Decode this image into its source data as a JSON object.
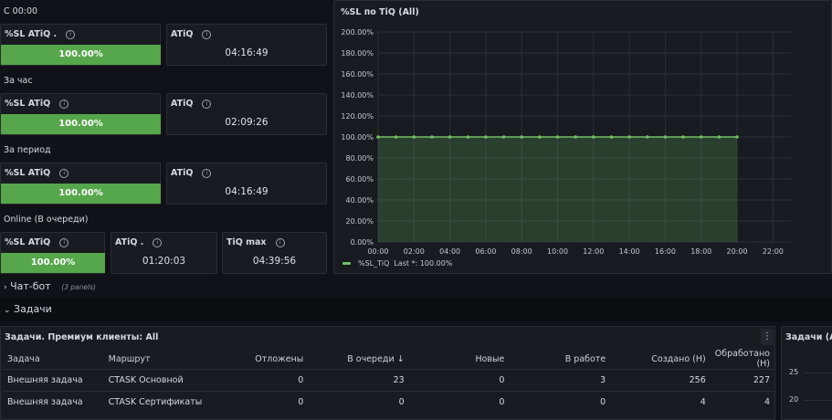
{
  "sections": {
    "since_midnight": "С 00:00",
    "per_hour": "За час",
    "per_period": "За период",
    "online": "Online (В очереди)"
  },
  "stats": {
    "r1_sl_title": "%SL ATiQ .",
    "r1_sl_value": "100.00%",
    "r1_atiq_title": "ATiQ",
    "r1_atiq_value": "04:16:49",
    "r2_sl_title": "%SL ATiQ",
    "r2_sl_value": "100.00%",
    "r2_atiq_title": "ATiQ",
    "r2_atiq_value": "02:09:26",
    "r3_sl_title": "%SL ATiQ",
    "r3_sl_value": "100.00%",
    "r3_atiq_title": "ATiQ",
    "r3_atiq_value": "04:16:49",
    "r4_sl_title": "%SL ATiQ",
    "r4_sl_value": "100.00%",
    "r4_atiq_title": "ATiQ .",
    "r4_atiq_value": "01:20:03",
    "r4_tiq_title": "TiQ max",
    "r4_tiq_value": "04:39:56",
    "bar_fill_fraction": 1.0
  },
  "chart_panel": {
    "title": "%SL по TiQ (All)",
    "legend_series": "%SL_TiQ",
    "legend_last": "Last *: 100.00%"
  },
  "chart_data": {
    "type": "area",
    "title": "%SL по TiQ (All)",
    "x_ticks": [
      "00:00",
      "02:00",
      "04:00",
      "06:00",
      "08:00",
      "10:00",
      "12:00",
      "14:00",
      "16:00",
      "18:00",
      "20:00",
      "22:00"
    ],
    "y_ticks": [
      "0.00%",
      "20.00%",
      "40.00%",
      "60.00%",
      "80.00%",
      "100.00%",
      "120.00%",
      "140.00%",
      "160.00%",
      "180.00%",
      "200.00%"
    ],
    "ylim": [
      0,
      200
    ],
    "xlim_hours": [
      0,
      23
    ],
    "series": [
      {
        "name": "%SL_TiQ",
        "color": "#73bf69",
        "x_hours": [
          0,
          1,
          2,
          3,
          4,
          5,
          6,
          7,
          8,
          9,
          10,
          11,
          12,
          13,
          14,
          15,
          16,
          17,
          18,
          19,
          20
        ],
        "values": [
          100,
          100,
          100,
          100,
          100,
          100,
          100,
          100,
          100,
          100,
          100,
          100,
          100,
          100,
          100,
          100,
          100,
          100,
          100,
          100,
          100
        ]
      }
    ],
    "grid": true,
    "legend": "bottom-left"
  },
  "rows": {
    "chatbot_label": "Чат-бот",
    "chatbot_meta": "(3 panels)",
    "tasks_label": "Задачи"
  },
  "tasks_table": {
    "title": "Задачи. Премиум клиенты: All",
    "columns": [
      "Задача",
      "Маршрут",
      "Отложены",
      "В очереди",
      "Новые",
      "В работе",
      "Создано (Н)",
      "Обработано (Н)"
    ],
    "sort_indicator": "↓",
    "rows": [
      [
        "Внешняя задача",
        "CTASK Основной",
        "0",
        "23",
        "0",
        "3",
        "256",
        "227"
      ],
      [
        "Внешняя задача",
        "CTASK Сертификаты",
        "0",
        "0",
        "0",
        "0",
        "4",
        "4"
      ]
    ]
  },
  "right_panel": {
    "title": "Задачи (All",
    "y_ticks": [
      "25",
      "20"
    ]
  },
  "colors": {
    "background": "#111217",
    "panel": "#181b1f",
    "stat_green": "#56a64b",
    "series_green": "#73bf69"
  }
}
